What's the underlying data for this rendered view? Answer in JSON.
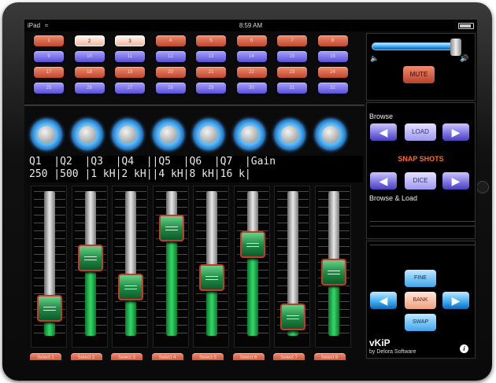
{
  "status": {
    "carrier": "iPad",
    "time": "8:59 AM"
  },
  "pads": [
    [
      "1",
      "2",
      "3",
      "4",
      "5",
      "6",
      "7",
      "8"
    ],
    [
      "9",
      "10",
      "11",
      "12",
      "13",
      "14",
      "15",
      "16"
    ],
    [
      "17",
      "18",
      "19",
      "20",
      "21",
      "22",
      "23",
      "24"
    ],
    [
      "25",
      "26",
      "27",
      "28",
      "29",
      "30",
      "31",
      "32"
    ]
  ],
  "pad_rows_color": [
    "red",
    "blue",
    "red",
    "blue"
  ],
  "active_pads": [
    "2",
    "3"
  ],
  "lcd": {
    "line1": "Q1  |Q2  |Q3  |Q4  ||Q5  |Q6  |Q7  |Gain",
    "line2": "250 |500 |1 kH|2 kH||4 kH|8 kH|16 k|"
  },
  "faders": [
    0.12,
    0.55,
    0.3,
    0.8,
    0.38,
    0.66,
    0.05,
    0.43
  ],
  "select_buttons": [
    "Select 1",
    "Select 2",
    "Select 3",
    "Select 4",
    "Select 5",
    "Select 6",
    "Select 7",
    "Select 8"
  ],
  "right": {
    "volume": 0.92,
    "mute": "MUTE",
    "browse": "Browse",
    "load": "LOAD",
    "snapshots": "SNAP SHOTS",
    "dice": "DICE",
    "browse_load": "Browse & Load",
    "fine": "FINE",
    "bank": "BANK",
    "swap": "SWAP",
    "brand": "vKiP",
    "by": "by Delora Software",
    "info": "i"
  },
  "colors": {
    "red_pad": "#d8603f",
    "blue_pad": "#7a70e6",
    "fader_green": "#2fc85f",
    "knob_blue": "#3b9cec",
    "snap_orange": "#ff6a2a"
  }
}
